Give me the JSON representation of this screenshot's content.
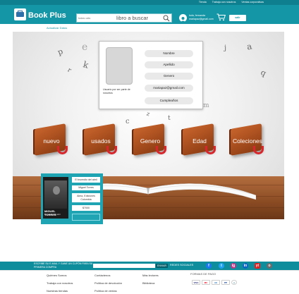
{
  "topbar": {
    "links": [
      "Tienda",
      "Trabaja con nosotros",
      "Ventas corporativas"
    ]
  },
  "header": {
    "brand": "Book Plus",
    "search_category": "todas cats",
    "search_placeholder": "libro a buscar",
    "user_line1": "hola, fernanda",
    "user_line2": "mariapaz@gmail.com",
    "exit_label": "salir"
  },
  "subnav": {
    "link": "Actualizar Datos"
  },
  "hero": {
    "letters": [
      "p",
      "k",
      "e",
      "r",
      "j",
      "a",
      "c",
      "z",
      "t",
      "q",
      "b",
      "m"
    ],
    "categories": [
      {
        "label": "nuevo"
      },
      {
        "label": "usados"
      },
      {
        "label": "Genero"
      },
      {
        "label": "Edad"
      },
      {
        "label": "Coleciones"
      }
    ]
  },
  "profile": {
    "since": "Usuario por ser parte de nosotros",
    "fields": [
      "Nombre",
      "Apellido",
      "Genero",
      "mariapaz@gmail.com",
      "Cumpleaños"
    ]
  },
  "book": {
    "cover_title": "MIGUEL TORRES",
    "cover_subtitle": "El incendio del abril",
    "title": "El incendio del abril",
    "author": "Miguel Torres",
    "publisher": "Alma, Ediciones Colombia",
    "price": "$7000"
  },
  "footer": {
    "promo": "ESCRIBE SU E-MAIL Y GANE UN CUPÓN PARA SU PRIMERA COMPRA",
    "send_label": "ENVIAR",
    "social_title": "REDES SOCIALES",
    "social": [
      "f",
      "t",
      "ig",
      "in",
      "yt",
      "o"
    ],
    "col1": [
      "Quiénes Somos",
      "Trabaja con nosotros",
      "Nuestras tiendas"
    ],
    "col2": [
      "Contáctenos",
      "Política de devolución",
      "Política de ventas"
    ],
    "col3": [
      "Más lectores",
      "Biblioteca"
    ],
    "pay_title": "FORMAS DE PAGO",
    "payments": [
      "VISA",
      "MC",
      "AE",
      "PP",
      "o"
    ],
    "colors": {
      "teal": "#1596a6",
      "dark_teal": "#0e8d9c",
      "accent_red": "#d8272c"
    }
  }
}
